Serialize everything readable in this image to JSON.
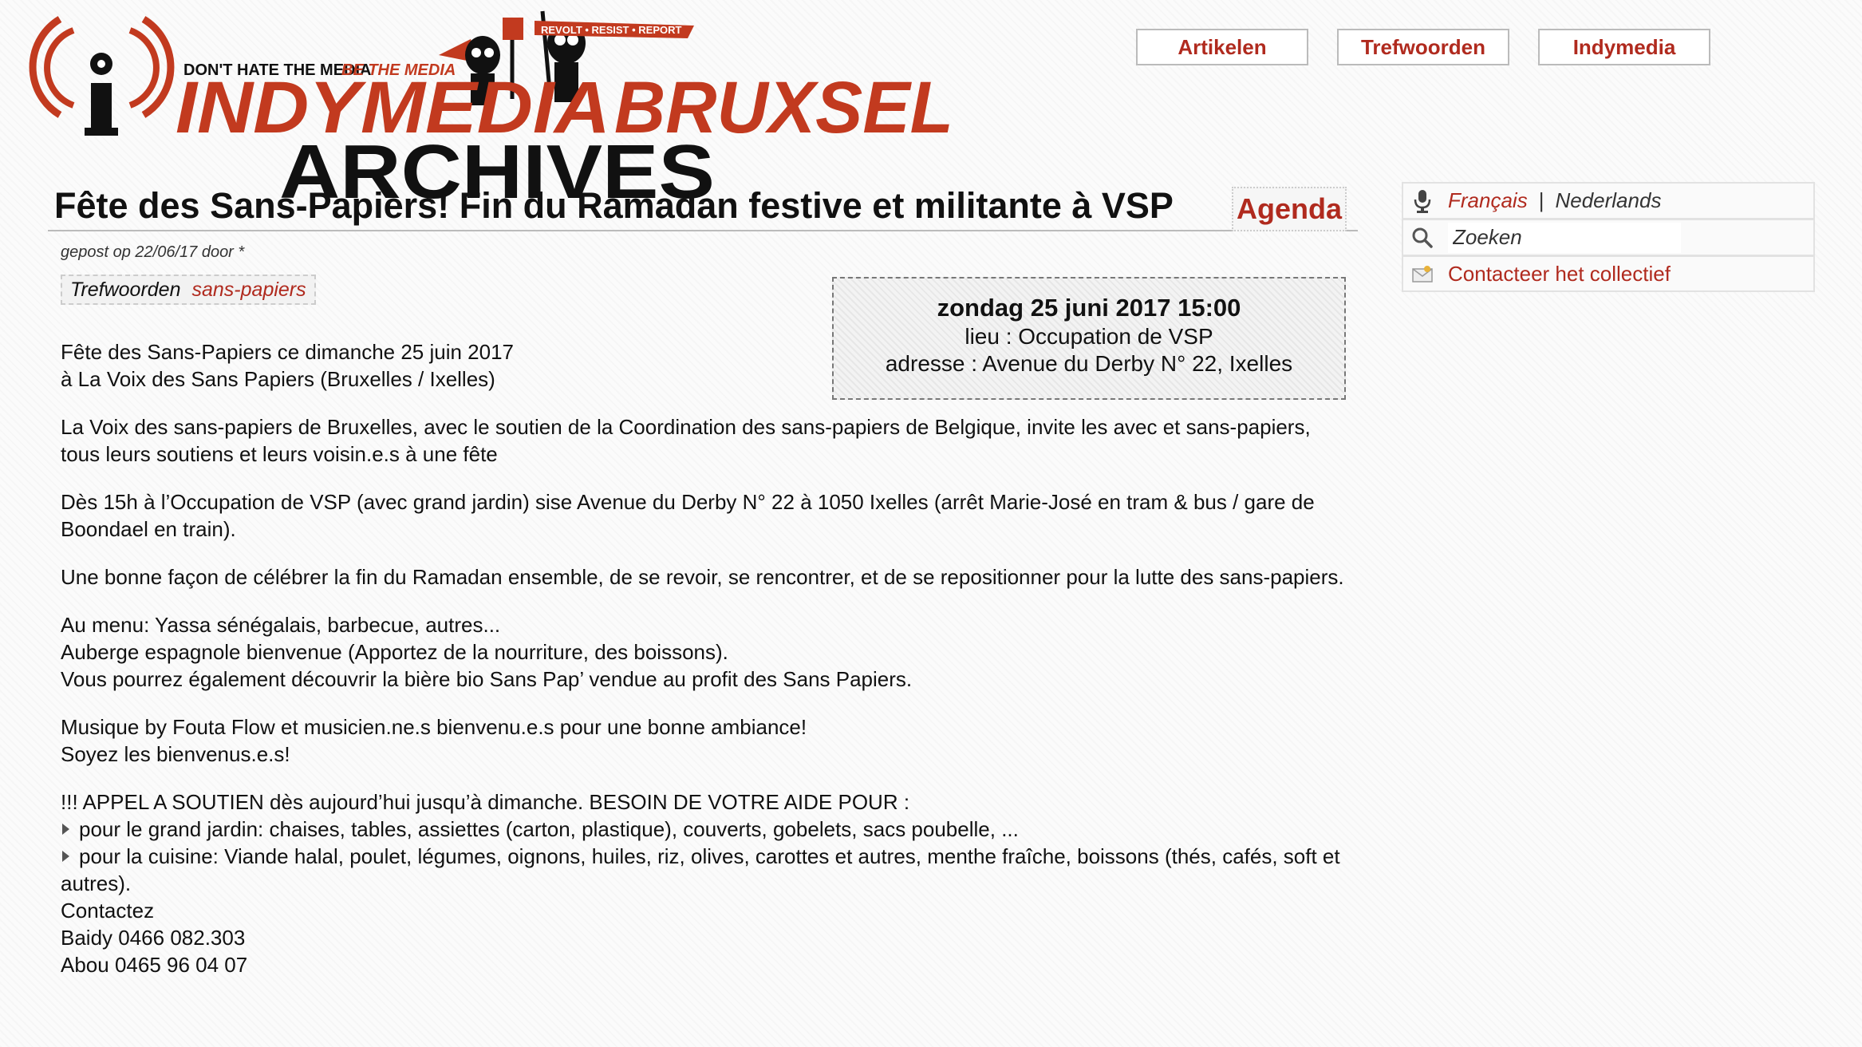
{
  "logo": {
    "slogan1": "DON'T HATE THE MEDIA",
    "slogan2": "BE THE MEDIA",
    "banner": "REVOLT • RESIST • REPORT",
    "name1": "INDYMEDIA",
    "name2": "BRUXSEL",
    "name3": "ARCHIVES",
    "colors": {
      "red": "#c23a1f",
      "black": "#111111"
    }
  },
  "nav": {
    "items": [
      {
        "label": "Artikelen"
      },
      {
        "label": "Trefwoorden"
      },
      {
        "label": "Indymedia"
      }
    ]
  },
  "article": {
    "title": "Fête des Sans-Papiers! Fin du Ramadan festive et militante à VSP",
    "category": "Agenda",
    "meta": "gepost op 22/06/17 door *",
    "tags_label": "Trefwoorden",
    "tags": [
      "sans-papiers"
    ],
    "event": {
      "date": "zondag 25 juni 2017 15:00",
      "place": "lieu : Occupation de VSP",
      "address": "adresse : Avenue du Derby N° 22, Ixelles"
    },
    "body": {
      "p1_l1": "Fête des Sans-Papiers ce dimanche 25 juin 2017",
      "p1_l2": "à La Voix des Sans Papiers (Bruxelles / Ixelles)",
      "p2": "La Voix des sans-papiers de Bruxelles, avec le soutien de la Coordination des sans-papiers de Belgique, invite les avec et sans-papiers, tous leurs soutiens et leurs voisin.e.s à une fête",
      "p3": "Dès 15h à l’Occupation de VSP (avec grand jardin) sise Avenue du Derby N° 22 à 1050 Ixelles (arrêt Marie-José en tram & bus / gare de Boondael en train).",
      "p4": "Une bonne façon de célébrer la fin du Ramadan ensemble, de se revoir, se rencontrer, et de se repositionner pour la lutte des sans-papiers.",
      "p5_l1": "Au menu: Yassa sénégalais, barbecue, autres...",
      "p5_l2": "Auberge espagnole bienvenue (Apportez de la nourriture, des boissons).",
      "p5_l3": "Vous pourrez également découvrir la bière bio Sans Pap’ vendue au profit des Sans Papiers.",
      "p6_l1": "Musique by Fouta Flow et musicien.ne.s bienvenu.e.s pour une bonne ambiance!",
      "p6_l2": "Soyez les bienvenus.e.s!",
      "p7_l1": "!!! APPEL A SOUTIEN dès aujourd’hui jusqu’à dimanche. BESOIN DE VOTRE AIDE POUR :",
      "bullet1": "pour le grand jardin: chaises, tables, assiettes (carton, plastique), couverts, gobelets, sacs poubelle, ...",
      "bullet2": "pour la cuisine: Viande halal, poulet, légumes, oignons, huiles, riz, olives, carottes et autres, menthe fraîche, boissons (thés, cafés, soft et autres).",
      "contact_l1": "Contactez",
      "contact_l2": "Baidy 0466 082.303",
      "contact_l3": "Abou 0465 96 04 07"
    }
  },
  "sidebar": {
    "lang_fr": "Français",
    "lang_sep": "|",
    "lang_nl": "Nederlands",
    "search_placeholder": "Zoeken",
    "contact": "Contacteer het collectief",
    "icons": [
      "microphone-icon",
      "search-icon",
      "envelope-icon"
    ]
  },
  "colors": {
    "accent": "#b02a1e"
  }
}
